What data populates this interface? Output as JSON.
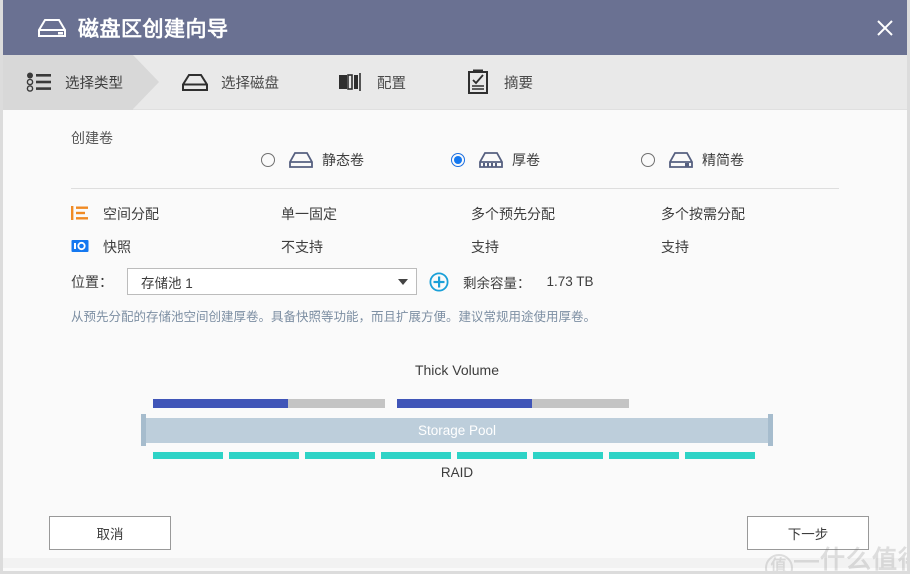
{
  "window": {
    "title": "磁盘区创建向导",
    "title_icon": "drive-icon",
    "close_icon": "close-icon",
    "titlebar_color": "#6a7192"
  },
  "steps": [
    {
      "label": "选择类型",
      "icon": "list-select-icon",
      "active": true
    },
    {
      "label": "选择磁盘",
      "icon": "disk-icon",
      "active": false
    },
    {
      "label": "配置",
      "icon": "config-bars-icon",
      "active": false
    },
    {
      "label": "摘要",
      "icon": "clipboard-check-icon",
      "active": false
    }
  ],
  "main": {
    "section_title": "创建卷",
    "options": [
      {
        "label": "静态卷",
        "icon": "static-volume-icon",
        "selected": false
      },
      {
        "label": "厚卷",
        "icon": "thick-volume-icon",
        "selected": true
      },
      {
        "label": "精简卷",
        "icon": "thin-volume-icon",
        "selected": false
      }
    ],
    "comparison": [
      {
        "icon": "space-allocation-icon",
        "icon_color": "#f08a24",
        "name": "空间分配",
        "values": [
          "单一固定",
          "多个预先分配",
          "多个按需分配"
        ]
      },
      {
        "icon": "snapshot-icon",
        "icon_color": "#1478f0",
        "name": "快照",
        "values": [
          "不支持",
          "支持",
          "支持"
        ]
      }
    ],
    "location": {
      "label": "位置：",
      "selected": "存储池 1",
      "dropdown_icon": "chevron-down-icon",
      "add_icon": "plus-circle-icon",
      "capacity_label": "剩余容量：",
      "capacity_value": "1.73 TB"
    },
    "description": "从预先分配的存储池空间创建厚卷。具备快照等功能，而且扩展方便。建议常规用途使用厚卷。",
    "diagram": {
      "top_label": "Thick Volume",
      "pool_label": "Storage Pool",
      "bottom_label": "RAID",
      "volume_bars": [
        {
          "used_percent": 58
        },
        {
          "used_percent": 58
        }
      ],
      "raid_segment_count": 8,
      "colors": {
        "volume_used": "#4055b8",
        "volume_free": "#c4c4c4",
        "pool": "#bdcedb",
        "pool_bracket": "#a6bccd",
        "raid": "#2ed3c6"
      }
    }
  },
  "footer": {
    "cancel_label": "取消",
    "next_label": "下一步"
  },
  "watermark": {
    "mark": "值",
    "text": "—什么值得买"
  }
}
